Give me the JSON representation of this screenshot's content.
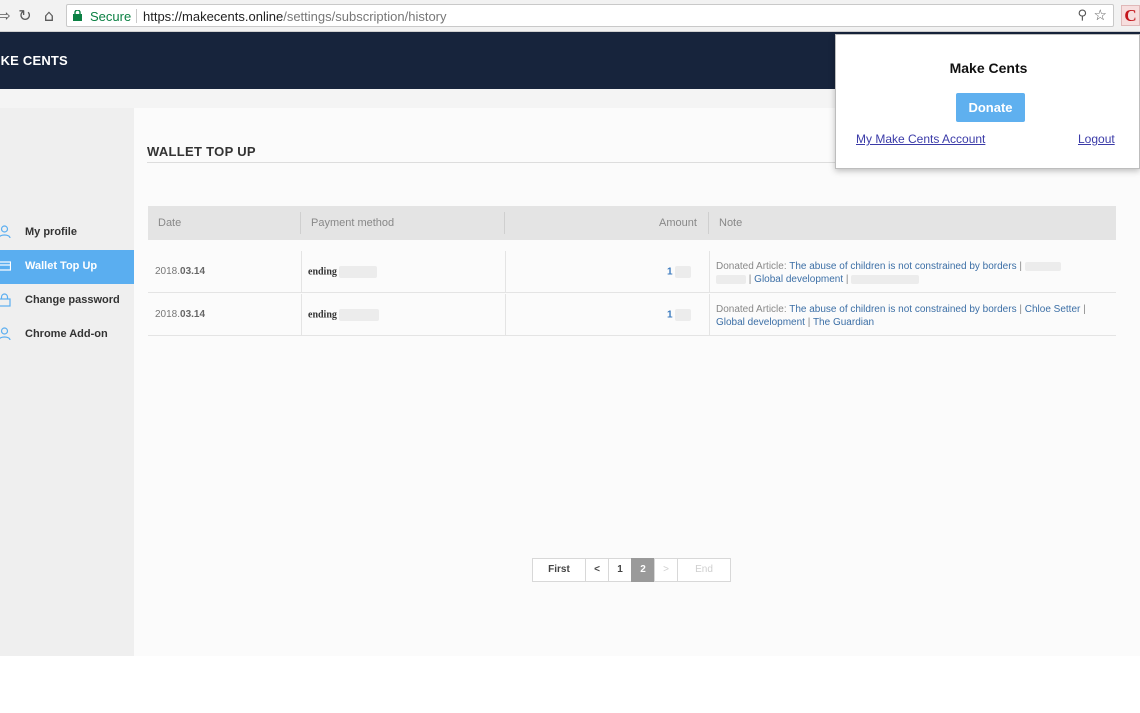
{
  "browser": {
    "secure_label": "Secure",
    "url_host": "https://makecents.online",
    "url_path": "/settings/subscription/history"
  },
  "app": {
    "logo": "AKE CENTS"
  },
  "sidebar": {
    "items": [
      {
        "label": "My profile",
        "icon": "user-icon"
      },
      {
        "label": "Wallet Top Up",
        "icon": "wallet-icon",
        "active": true
      },
      {
        "label": "Change password",
        "icon": "lock-icon"
      },
      {
        "label": "Chrome Add-on",
        "icon": "user-icon"
      }
    ]
  },
  "main": {
    "title": "WALLET TOP UP",
    "table": {
      "headers": [
        "Date",
        "Payment method",
        "Amount",
        "Note"
      ],
      "rows": [
        {
          "date_prefix": "2018.",
          "date_bold": "03.14",
          "payment": "ending",
          "amount": "1",
          "note_prefix": "Donated Article:",
          "article": "The abuse of children is not constrained by borders",
          "category": "Global development",
          "author": "",
          "publisher": ""
        },
        {
          "date_prefix": "2018.",
          "date_bold": "03.14",
          "payment": "ending",
          "amount": "1",
          "note_prefix": "Donated Article:",
          "article": "The abuse of children is not constrained by borders",
          "category": "Global development",
          "author": "Chloe Setter",
          "publisher": "The Guardian"
        }
      ]
    },
    "pagination": {
      "first": "First",
      "prev": "<",
      "pages": [
        "1",
        "2"
      ],
      "current": "2",
      "next": ">",
      "end": "End"
    }
  },
  "popup": {
    "title": "Make Cents",
    "donate_label": "Donate",
    "account_link": "My Make Cents Account",
    "logout_link": "Logout"
  },
  "colors": {
    "header_bg": "#17243c",
    "accent": "#5aaef0",
    "link": "#3c6fa6"
  }
}
